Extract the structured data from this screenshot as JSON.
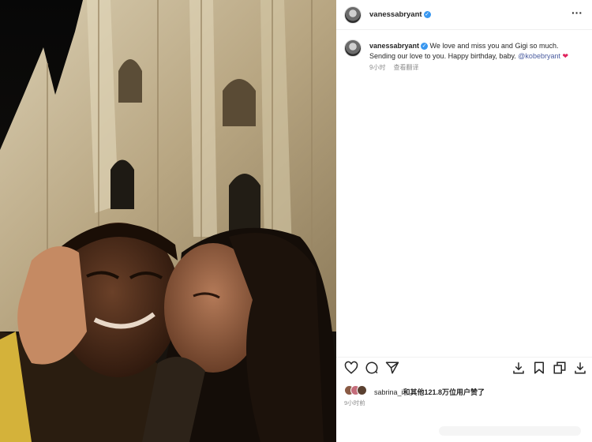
{
  "header": {
    "username": "vanessabryant",
    "more_label": "···"
  },
  "caption": {
    "username": "vanessabryant",
    "text": " We love and miss you and Gigi so much. Sending our love to you. Happy birthday, baby. ",
    "mention": "@kobebryant",
    "heart": "❤",
    "time": "9小时",
    "translate_label": "查看翻译"
  },
  "likes": {
    "user": "sabrina_i",
    "text": "和其他121.8万位用户赞了"
  },
  "post_time": "9小时前",
  "icons": [
    "heart-icon",
    "comment-icon",
    "share-icon",
    "download-icon",
    "bookmark-icon",
    "copy-icon",
    "download-icon"
  ],
  "colors": {
    "verified": "#3897f0",
    "mention": "#4a5c9f",
    "heart": "#e0245e",
    "muted": "#8e8e8e"
  }
}
